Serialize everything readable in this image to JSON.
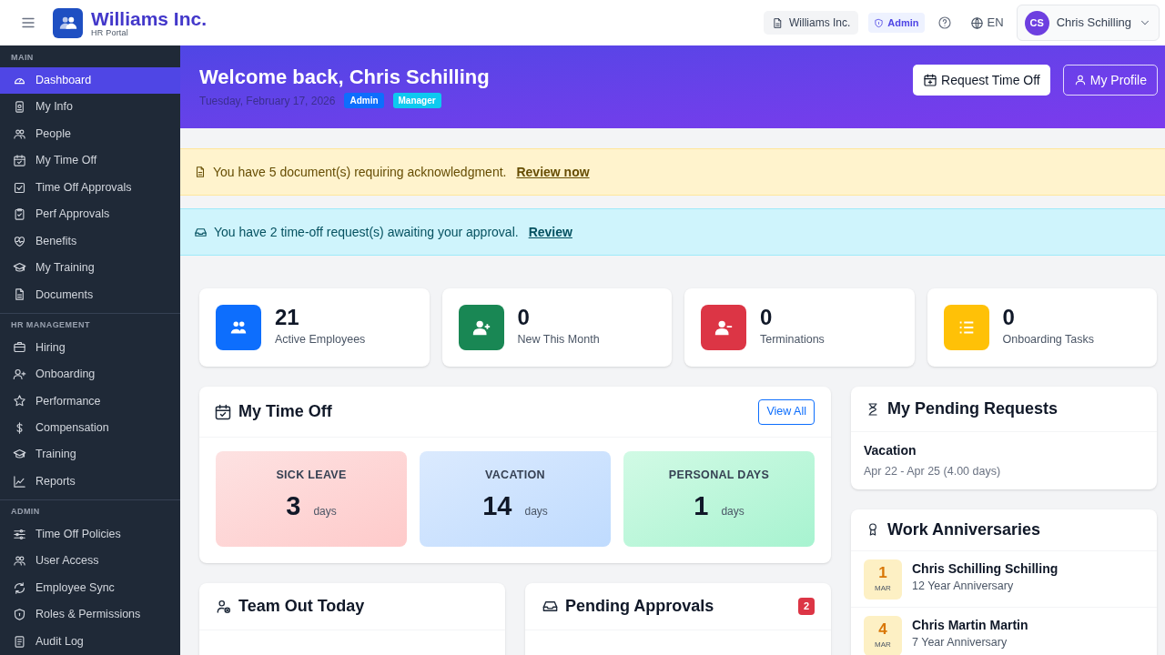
{
  "header": {
    "brand": "Williams Inc.",
    "subtitle": "HR Portal",
    "company": "Williams Inc.",
    "role_badge": "Admin",
    "language": "EN",
    "user": {
      "initials": "CS",
      "name": "Chris Schilling"
    }
  },
  "sidebar": {
    "sections": [
      {
        "title": "MAIN",
        "items": [
          {
            "label": "Dashboard",
            "selected": true
          },
          {
            "label": "My Info",
            "selected": false
          },
          {
            "label": "People",
            "selected": false
          },
          {
            "label": "My Time Off",
            "selected": false
          },
          {
            "label": "Time Off Approvals",
            "selected": false
          },
          {
            "label": "Perf Approvals",
            "selected": false
          },
          {
            "label": "Benefits",
            "selected": false
          },
          {
            "label": "My Training",
            "selected": false
          },
          {
            "label": "Documents",
            "selected": false
          }
        ]
      },
      {
        "title": "HR MANAGEMENT",
        "items": [
          {
            "label": "Hiring",
            "selected": false
          },
          {
            "label": "Onboarding",
            "selected": false
          },
          {
            "label": "Performance",
            "selected": false
          },
          {
            "label": "Compensation",
            "selected": false
          },
          {
            "label": "Training",
            "selected": false
          },
          {
            "label": "Reports",
            "selected": false
          }
        ]
      },
      {
        "title": "ADMIN",
        "items": [
          {
            "label": "Time Off Policies",
            "selected": false
          },
          {
            "label": "User Access",
            "selected": false
          },
          {
            "label": "Employee Sync",
            "selected": false
          },
          {
            "label": "Roles & Permissions",
            "selected": false
          },
          {
            "label": "Audit Log",
            "selected": false
          }
        ]
      }
    ]
  },
  "hero": {
    "title": "Welcome back, Chris Schilling",
    "date": "Tuesday, February 17, 2026",
    "badges": [
      {
        "label": "Admin",
        "color": "#0d6efd"
      },
      {
        "label": "Manager",
        "color": "#0dcaf0"
      }
    ],
    "buttons": [
      {
        "label": "Request Time Off",
        "kind": "solid"
      },
      {
        "label": "My Profile",
        "kind": "outline"
      }
    ]
  },
  "alerts": [
    {
      "kind": "warning",
      "text": "You have 5 document(s) requiring acknowledgment.",
      "link": "Review now"
    },
    {
      "kind": "info",
      "text": "You have 2 time-off request(s) awaiting your approval.",
      "link": "Review"
    }
  ],
  "stats": [
    {
      "value": "21",
      "label": "Active Employees",
      "color": "#0d6efd"
    },
    {
      "value": "0",
      "label": "New This Month",
      "color": "#198754"
    },
    {
      "value": "0",
      "label": "Terminations",
      "color": "#dc3545"
    },
    {
      "value": "0",
      "label": "Onboarding Tasks",
      "color": "#ffc107"
    }
  ],
  "time_off": {
    "title": "My Time Off",
    "button": "View All",
    "balances": [
      {
        "label": "SICK LEAVE",
        "value": "3",
        "unit": "days",
        "kind": "sick"
      },
      {
        "label": "VACATION",
        "value": "14",
        "unit": "days",
        "kind": "vacation"
      },
      {
        "label": "PERSONAL DAYS",
        "value": "1",
        "unit": "days",
        "kind": "personal"
      }
    ]
  },
  "team_out": {
    "title": "Team Out Today"
  },
  "pending_approvals": {
    "title": "Pending Approvals",
    "count": "2"
  },
  "pending_requests": {
    "title": "My Pending Requests",
    "items": [
      {
        "type": "Vacation",
        "dates": "Apr 22 - Apr 25 (4.00 days)"
      }
    ]
  },
  "anniversaries": {
    "title": "Work Anniversaries",
    "items": [
      {
        "day": "1",
        "month": "MAR",
        "name": "Chris Schilling Schilling",
        "years": "12 Year Anniversary"
      },
      {
        "day": "4",
        "month": "MAR",
        "name": "Chris Martin Martin",
        "years": "7 Year Anniversary"
      }
    ]
  }
}
